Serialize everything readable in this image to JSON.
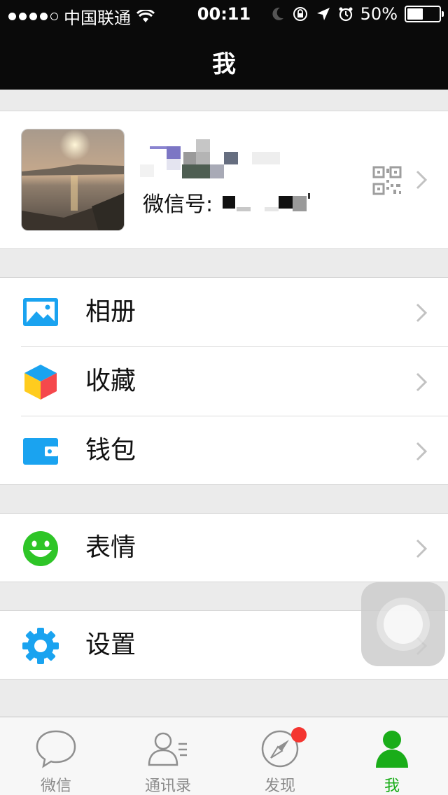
{
  "status_bar": {
    "carrier": "中国联通",
    "time": "00:11",
    "battery_text": "50%",
    "battery_level": 0.5
  },
  "nav": {
    "title": "我"
  },
  "profile": {
    "wechat_id_label": "微信号:"
  },
  "menu": {
    "group1": [
      {
        "label": "相册",
        "icon": "photo-album-icon"
      },
      {
        "label": "收藏",
        "icon": "favorites-cube-icon"
      },
      {
        "label": "钱包",
        "icon": "wallet-icon"
      }
    ],
    "group2": [
      {
        "label": "表情",
        "icon": "smiley-face-icon"
      }
    ],
    "group3": [
      {
        "label": "设置",
        "icon": "gear-icon"
      }
    ]
  },
  "tabs": [
    {
      "label": "微信",
      "icon": "chat-bubble-icon",
      "active": false
    },
    {
      "label": "通讯录",
      "icon": "contacts-icon",
      "active": false
    },
    {
      "label": "发现",
      "icon": "compass-icon",
      "active": false,
      "badge": true
    },
    {
      "label": "我",
      "icon": "person-icon",
      "active": true
    }
  ],
  "colors": {
    "accent_green": "#1aad19",
    "badge_red": "#f43530",
    "icon_blue": "#1aa3f0",
    "nav_bg": "#0a0a0a"
  }
}
